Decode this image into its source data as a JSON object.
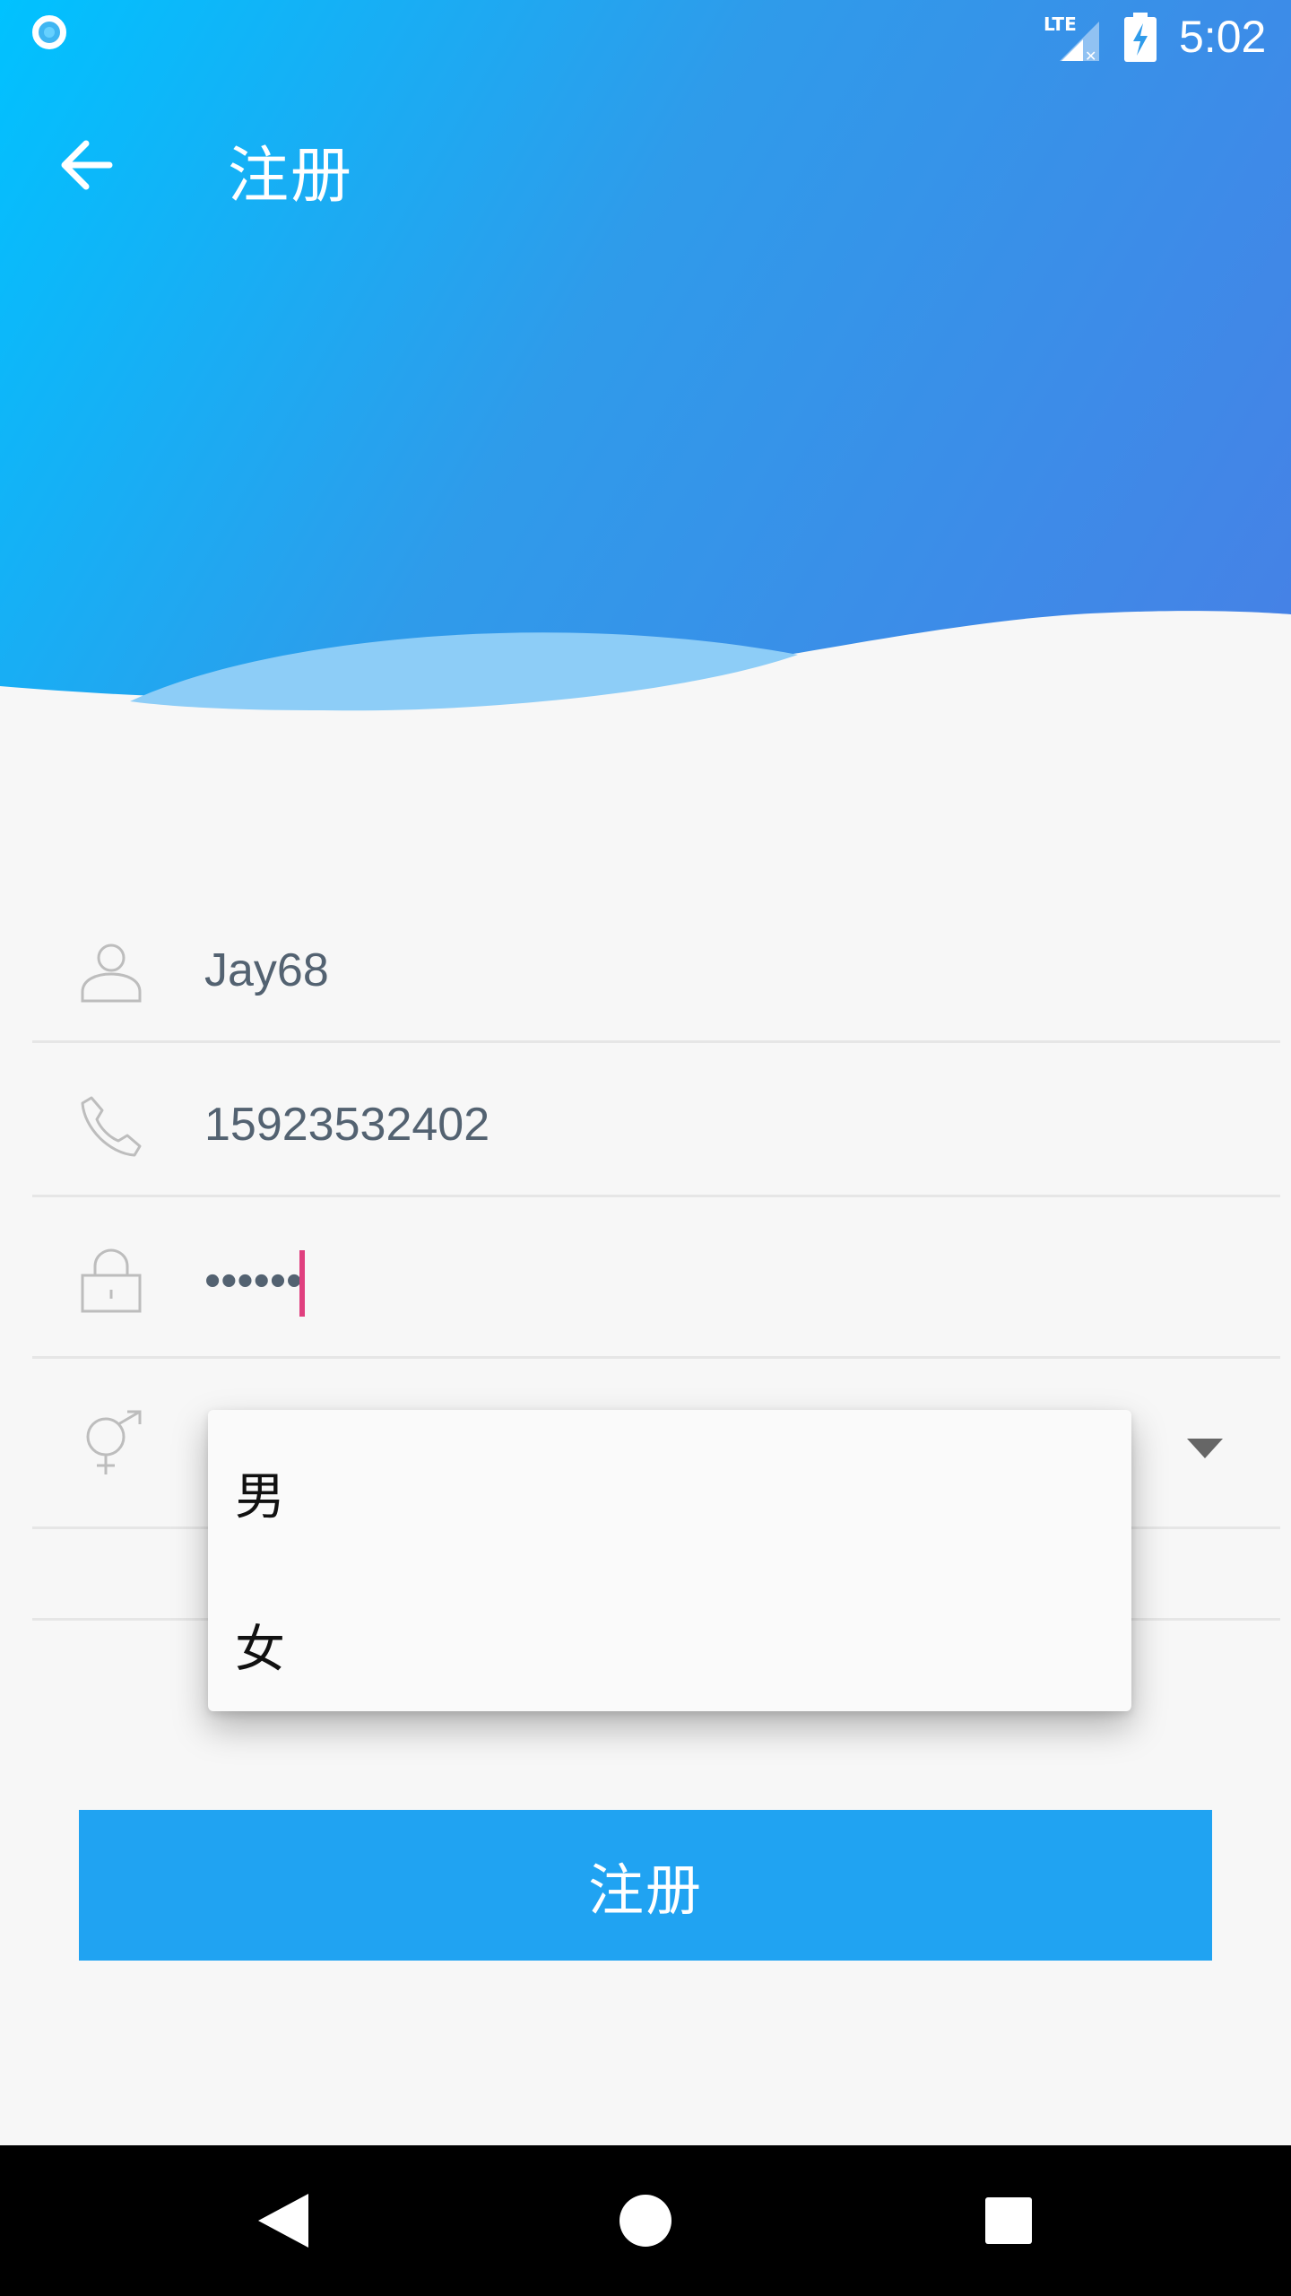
{
  "status_bar": {
    "time": "5:02",
    "network_label": "LTE",
    "icons": [
      "notification-dot-icon",
      "lte-signal-icon",
      "battery-charging-icon"
    ]
  },
  "app_bar": {
    "title": "注册",
    "back_icon": "arrow-back-icon"
  },
  "form": {
    "username": {
      "icon": "person-icon",
      "value": "Jay68"
    },
    "phone": {
      "icon": "phone-icon",
      "value": "15923532402"
    },
    "password": {
      "icon": "lock-icon",
      "value": "••••••"
    },
    "gender": {
      "icon": "gender-icon",
      "dropdown_icon": "dropdown-arrow-icon"
    }
  },
  "gender_menu": {
    "options": [
      "男",
      "女"
    ]
  },
  "register_button": {
    "label": "注册"
  },
  "nav_bar": {
    "icons": [
      "nav-back-icon",
      "nav-home-icon",
      "nav-recent-icon"
    ]
  },
  "colors": {
    "header_start": "#00c2ff",
    "header_end": "#4780e6",
    "button": "#20a3f2",
    "cursor": "#e0407f",
    "field_text": "#536271"
  }
}
